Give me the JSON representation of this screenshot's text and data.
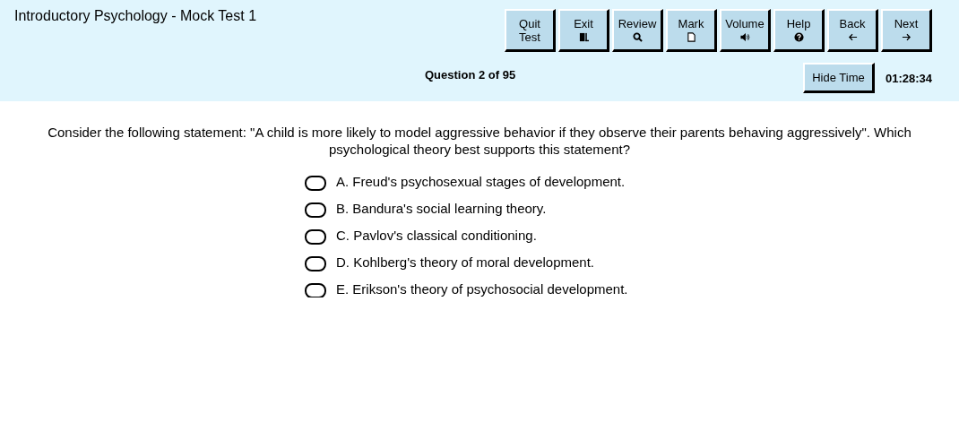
{
  "title": "Introductory Psychology - Mock Test 1",
  "toolbar": [
    {
      "label": "Quit",
      "sublabel": "Test",
      "kind": "plain"
    },
    {
      "label": "Exit",
      "kind": "door"
    },
    {
      "label": "Review",
      "kind": "search"
    },
    {
      "label": "Mark",
      "kind": "page"
    },
    {
      "label": "Volume",
      "kind": "speaker"
    },
    {
      "label": "Help",
      "kind": "help"
    },
    {
      "label": "Back",
      "kind": "left"
    },
    {
      "label": "Next",
      "kind": "right"
    }
  ],
  "progress": "Question 2 of 95",
  "hide_time_button": "Hide Time",
  "timer": "01:28:34",
  "question": "Consider the following statement: \"A child is more likely to model aggressive behavior if they observe their parents behaving aggressively\". Which psychological theory best supports this statement?",
  "options": [
    {
      "label": "A. Freud's psychosexual stages of development.",
      "selected": false
    },
    {
      "label": "B. Bandura's social learning theory.",
      "selected": false
    },
    {
      "label": "C. Pavlov's classical conditioning.",
      "selected": false
    },
    {
      "label": "D. Kohlberg's theory of moral development.",
      "selected": false
    },
    {
      "label": "E. Erikson's theory of psychosocial development.",
      "selected": false
    }
  ]
}
